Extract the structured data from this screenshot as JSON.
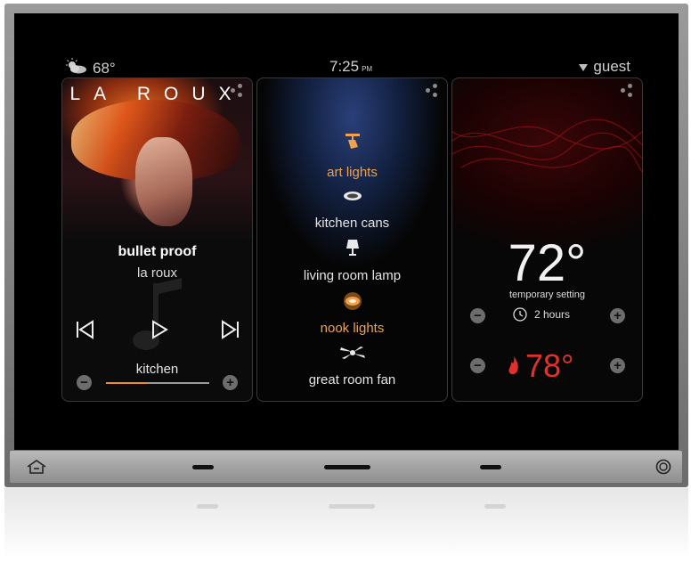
{
  "status": {
    "weather_icon": "partly-cloudy-icon",
    "outdoor_temp": "68°",
    "time": "7:25",
    "ampm": "PM",
    "user": "guest"
  },
  "music": {
    "artist_logo": "LA ROUX",
    "song": "bullet proof",
    "artist": "la roux",
    "room": "kitchen",
    "volume_fraction": 0.4,
    "accent_color": "#f08a2a"
  },
  "lights": {
    "items": [
      {
        "label": "art lights",
        "state": "on",
        "icon": "spotlight-icon"
      },
      {
        "label": "kitchen cans",
        "state": "off",
        "icon": "recessed-light-icon"
      },
      {
        "label": "living room lamp",
        "state": "off",
        "icon": "lamp-icon"
      },
      {
        "label": "nook lights",
        "state": "on",
        "icon": "ceiling-light-icon"
      },
      {
        "label": "great room fan",
        "state": "off",
        "icon": "fan-icon"
      }
    ],
    "on_color": "#f0a14a"
  },
  "climate": {
    "current_temp": "72°",
    "mode_label": "temporary setting",
    "duration": "2 hours",
    "setpoint": "78°",
    "heat_color": "#e2302a"
  }
}
